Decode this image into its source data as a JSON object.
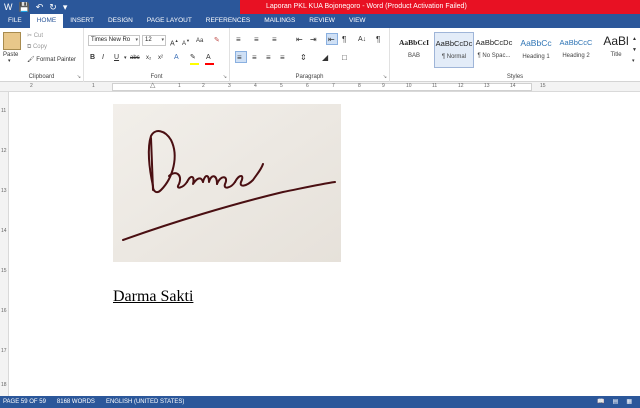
{
  "window": {
    "title": "Laporan PKL KUA Bojonegoro - Word (Product Activation Failed)",
    "qat": {
      "save_icon": "save-icon",
      "undo_icon": "undo-icon",
      "redo_icon": "redo-icon"
    }
  },
  "tabs": [
    "FILE",
    "HOME",
    "INSERT",
    "DESIGN",
    "PAGE LAYOUT",
    "REFERENCES",
    "MAILINGS",
    "REVIEW",
    "VIEW"
  ],
  "active_tab": "HOME",
  "clipboard": {
    "paste_label": "Paste",
    "cut_label": "Cut",
    "copy_label": "Copy",
    "format_painter_label": "Format Painter",
    "group_label": "Clipboard"
  },
  "font": {
    "family": "Times New Ro",
    "size": "12",
    "grow": "A",
    "shrink": "A",
    "case": "Aa",
    "bold": "B",
    "italic": "I",
    "underline": "U",
    "strike": "abc",
    "subscript": "x₂",
    "superscript": "x²",
    "group_label": "Font"
  },
  "paragraph": {
    "group_label": "Paragraph",
    "pilcrow": "¶"
  },
  "styles": {
    "group_label": "Styles",
    "items": [
      {
        "sample": "AaBbCcI",
        "name": "BAB"
      },
      {
        "sample": "AaBbCcDc",
        "name": "¶ Normal"
      },
      {
        "sample": "AaBbCcDc",
        "name": "¶ No Spac..."
      },
      {
        "sample": "AaBbCc",
        "name": "Heading 1"
      },
      {
        "sample": "AaBbCcC",
        "name": "Heading 2"
      },
      {
        "sample": "AaBl",
        "name": "Title"
      }
    ]
  },
  "ruler": {
    "h_ticks": [
      "2",
      "1",
      "1",
      "2",
      "3",
      "4",
      "5",
      "6",
      "7",
      "8",
      "9",
      "10",
      "11",
      "12",
      "13",
      "14",
      "15"
    ],
    "v_ticks": [
      "11",
      "12",
      "13",
      "14",
      "15",
      "16",
      "17",
      "18"
    ]
  },
  "document": {
    "name": "Darma Sakti"
  },
  "status": {
    "page": "PAGE 59 OF 59",
    "words": "8168 WORDS",
    "language": "ENGLISH (UNITED STATES)"
  }
}
